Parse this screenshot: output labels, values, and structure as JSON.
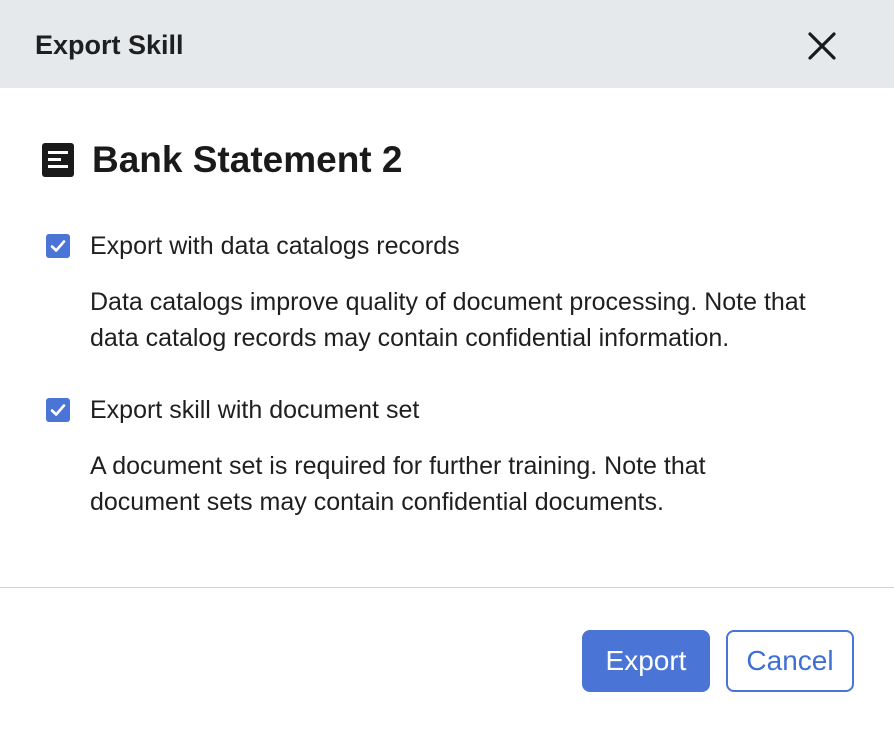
{
  "dialog": {
    "title": "Export Skill",
    "close_icon": "close-icon",
    "skill": {
      "icon": "document-icon",
      "name": "Bank Statement 2"
    },
    "options": [
      {
        "label": "Export with data catalogs records",
        "checked": true,
        "description_lines": [
          "Data catalogs improve quality of document processing. Note that",
          "data catalog records may contain confidential information."
        ]
      },
      {
        "label": "Export skill with document set",
        "checked": true,
        "description_lines": [
          "A document set is required for further training. Note that",
          "document sets may contain confidential documents."
        ]
      }
    ],
    "buttons": {
      "export_label": "Export",
      "cancel_label": "Cancel"
    }
  },
  "colors": {
    "accent": "#4a74d6",
    "header_bg": "#e6e9ec",
    "text": "#1f1f1f"
  }
}
